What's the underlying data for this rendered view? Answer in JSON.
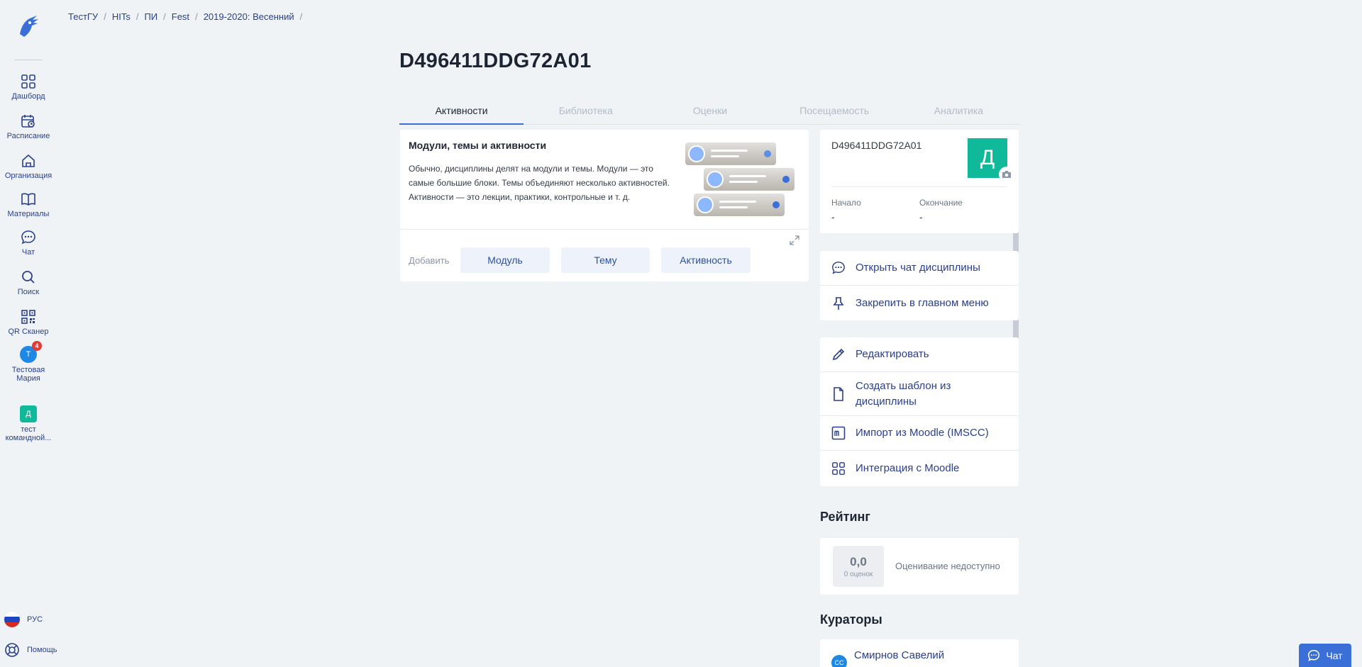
{
  "colors": {
    "accent": "#3a6fd8",
    "link": "#2a3f8c",
    "teal": "#10b99a",
    "badge": "#e53935",
    "background": "#eff3f6"
  },
  "sidebar": {
    "items": [
      {
        "label": "Дашборд",
        "icon": "dashboard-icon"
      },
      {
        "label": "Расписание",
        "icon": "calendar-icon"
      },
      {
        "label": "Организация",
        "icon": "home-icon"
      },
      {
        "label": "Материалы",
        "icon": "book-icon"
      },
      {
        "label": "Чат",
        "icon": "chat-icon"
      },
      {
        "label": "Поиск",
        "icon": "search-icon"
      },
      {
        "label": "QR Сканер",
        "icon": "qr-icon"
      }
    ],
    "user": {
      "initial": "Т",
      "badge": "4",
      "label": "Тестовая Мария"
    },
    "team": {
      "initial": "Д",
      "label": "тест командной..."
    },
    "language": "РУС",
    "help": "Помощь"
  },
  "breadcrumb": [
    "ТестГУ",
    "HITs",
    "ПИ",
    "Fest",
    "2019-2020: Весенний"
  ],
  "page": {
    "title": "D496411DDG72A01"
  },
  "tabs": [
    "Активности",
    "Библиотека",
    "Оценки",
    "Посещаемость",
    "Аналитика"
  ],
  "modules_card": {
    "title": "Модули, темы и активности",
    "text": "Обычно, дисциплины делят на модули и темы. Модули — это самые большие блоки. Темы объединяют несколько активностей. Активности — это лекции, практики, контрольные и т. д.",
    "add_label": "Добавить",
    "buttons": [
      "Модуль",
      "Тему",
      "Активность"
    ]
  },
  "info_card": {
    "name": "D496411DDG72A01",
    "avatar_initial": "Д",
    "start_label": "Начало",
    "start_value": "-",
    "end_label": "Окончание",
    "end_value": "-"
  },
  "actions_group1": [
    {
      "label": "Открыть чат дисциплины",
      "icon": "chat-icon"
    },
    {
      "label": "Закрепить в главном меню",
      "icon": "pin-icon"
    }
  ],
  "actions_group2": [
    {
      "label": "Редактировать",
      "icon": "pencil-icon"
    },
    {
      "label": "Создать шаблон из дисциплины",
      "icon": "document-icon"
    },
    {
      "label": "Импорт из Moodle (IMSCC)",
      "icon": "moodle-icon"
    },
    {
      "label": "Интеграция с Moodle",
      "icon": "grid-icon"
    }
  ],
  "rating": {
    "title": "Рейтинг",
    "value": "0,0",
    "count": "0 оценок",
    "note": "Оценивание недоступно"
  },
  "curators": {
    "title": "Кураторы",
    "items": [
      {
        "initials": "СС",
        "name": "Смирнов Савелий"
      }
    ]
  },
  "chat_button": "Чат"
}
